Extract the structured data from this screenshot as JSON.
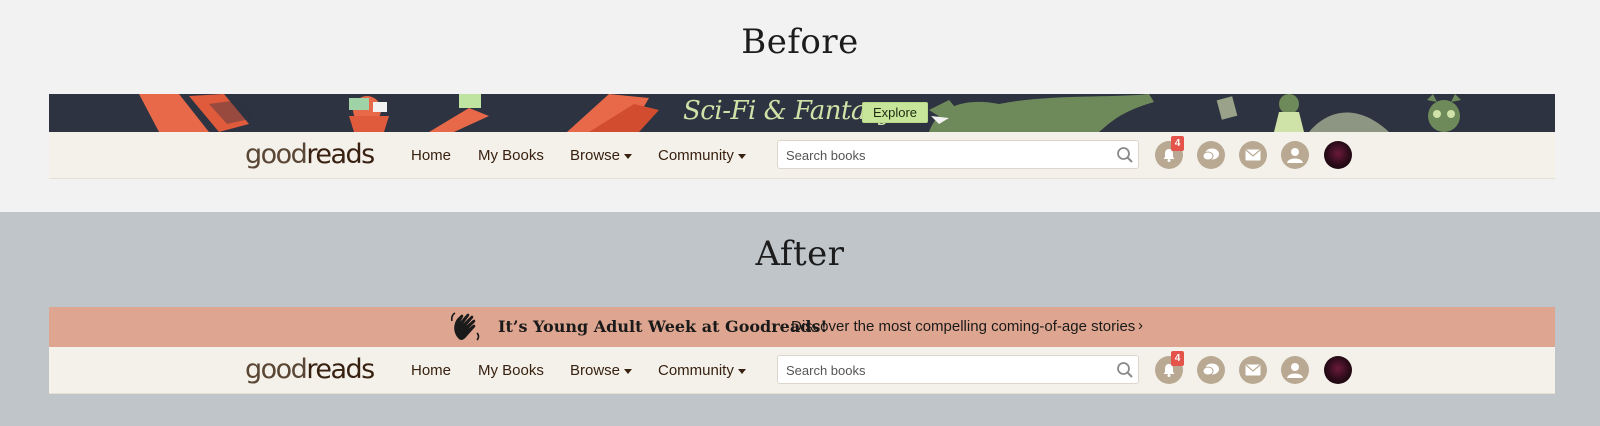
{
  "sections": {
    "before": {
      "title": "Before"
    },
    "after": {
      "title": "After"
    }
  },
  "scifi_banner": {
    "title": "Sci-Fi & Fantasy",
    "button_label": "Explore"
  },
  "ya_banner": {
    "title": "It’s Young Adult Week at Goodreads!",
    "subtitle": "Discover the most compelling coming-of-age stories",
    "chevron": "›"
  },
  "navbar": {
    "logo_good": "good",
    "logo_reads": "reads",
    "items": [
      {
        "label": "Home"
      },
      {
        "label": "My Books"
      },
      {
        "label": "Browse"
      },
      {
        "label": "Community"
      }
    ],
    "search_placeholder": "Search books",
    "notification_count": "4",
    "icons": [
      "notifications-icon",
      "chat-icon",
      "mail-icon",
      "friends-icon",
      "avatar"
    ]
  },
  "colors": {
    "before_bg": "#f2f2f2",
    "after_bg": "#c0c5ca",
    "scifi_banner_bg": "#2d3340",
    "ya_banner_bg": "#dea690",
    "navbar_bg": "#f4f1ea",
    "icon_bg": "#b9a993",
    "badge": "#e5544b"
  }
}
